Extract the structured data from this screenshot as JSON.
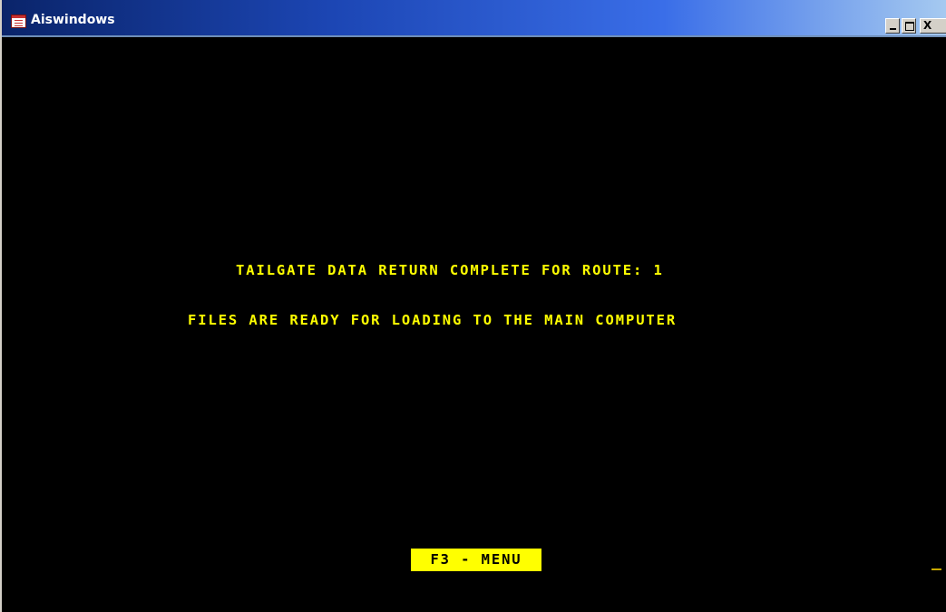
{
  "window": {
    "title": "Aiswindows",
    "controls": {
      "minimize": "_",
      "maximize": "□",
      "close": "X"
    },
    "app_icon": "window-list-icon"
  },
  "screen": {
    "line1": "TAILGATE DATA RETURN COMPLETE FOR ROUTE: 1",
    "line2": "FILES ARE READY FOR LOADING TO THE MAIN COMPUTER",
    "fkey_menu": "F3 - MENU"
  },
  "colors": {
    "background": "#000000",
    "text": "#ffff00",
    "highlight_bg": "#ffff00",
    "highlight_text": "#000000",
    "titlebar_start": "#0a246a",
    "titlebar_end": "#a6caf0"
  }
}
